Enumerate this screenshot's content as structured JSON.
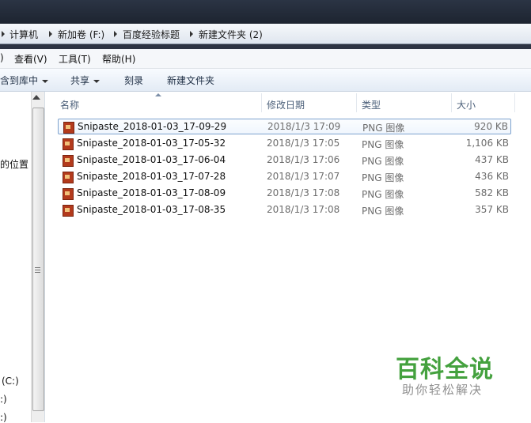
{
  "breadcrumb": [
    "计算机",
    "新加卷 (F:)",
    "百度经验标题",
    "新建文件夹 (2)"
  ],
  "menubar": [
    "查看(V)",
    "工具(T)",
    "帮助(H)"
  ],
  "menu_fragment": ")",
  "toolbar": {
    "include_library": "含到库中",
    "share": "共享",
    "burn": "刻录",
    "new_folder": "新建文件夹"
  },
  "nav": {
    "locations_fragment": "的位置",
    "drive_c": "(C:)",
    "drive_2": ":)",
    "drive_3": ":)"
  },
  "columns": {
    "name": "名称",
    "date": "修改日期",
    "type": "类型",
    "size": "大小"
  },
  "files": [
    {
      "name": "Snipaste_2018-01-03_17-09-29",
      "date": "2018/1/3 17:09",
      "type": "PNG 图像",
      "size": "920 KB"
    },
    {
      "name": "Snipaste_2018-01-03_17-05-32",
      "date": "2018/1/3 17:05",
      "type": "PNG 图像",
      "size": "1,106 KB"
    },
    {
      "name": "Snipaste_2018-01-03_17-06-04",
      "date": "2018/1/3 17:06",
      "type": "PNG 图像",
      "size": "437 KB"
    },
    {
      "name": "Snipaste_2018-01-03_17-07-28",
      "date": "2018/1/3 17:07",
      "type": "PNG 图像",
      "size": "436 KB"
    },
    {
      "name": "Snipaste_2018-01-03_17-08-09",
      "date": "2018/1/3 17:08",
      "type": "PNG 图像",
      "size": "582 KB"
    },
    {
      "name": "Snipaste_2018-01-03_17-08-35",
      "date": "2018/1/3 17:08",
      "type": "PNG 图像",
      "size": "357 KB"
    }
  ],
  "watermark": {
    "title": "百科全说",
    "subtitle": "助你轻松解决"
  }
}
